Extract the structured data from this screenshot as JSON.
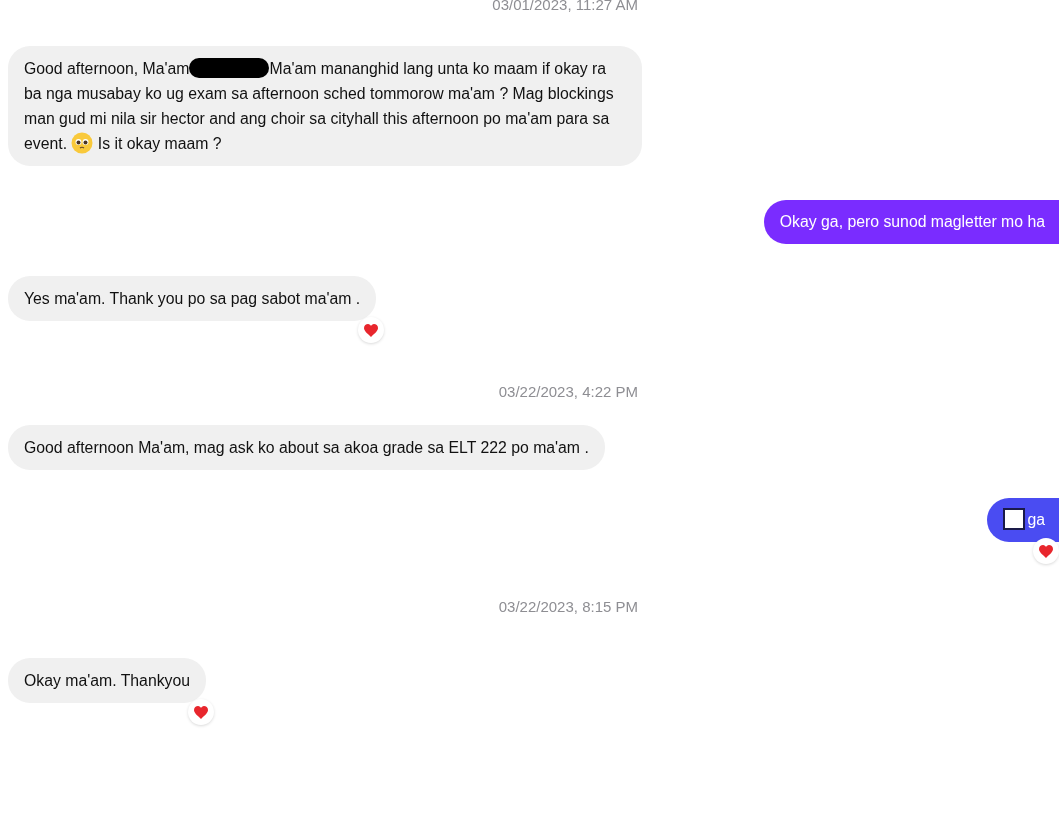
{
  "messages": [
    {
      "kind": "timestamp",
      "text": "03/01/2023, 11:27 AM"
    },
    {
      "kind": "incoming",
      "reacted": false,
      "parts": [
        {
          "kind": "text",
          "text": "Good afternoon, Ma'am"
        },
        {
          "kind": "redaction"
        },
        {
          "kind": "text",
          "text": "Ma'am mananghid lang unta ko maam if okay ra ba nga musabay ko ug exam sa afternoon sched tommorow ma'am ? Mag blockings man gud mi nila sir hector and ang choir sa cityhall this afternoon po ma'am para sa event. "
        },
        {
          "kind": "emoji"
        },
        {
          "kind": "text",
          "text": " Is it okay maam ?"
        }
      ]
    },
    {
      "kind": "outgoing",
      "color": "#7a2cff",
      "reacted": false,
      "parts": [
        {
          "kind": "text",
          "text": "Okay ga, pero sunod magletter mo ha"
        }
      ]
    },
    {
      "kind": "incoming",
      "reacted": true,
      "parts": [
        {
          "kind": "text",
          "text": "Yes ma'am. Thank you po sa pag sabot ma'am ."
        }
      ]
    },
    {
      "kind": "timestamp",
      "text": "03/22/2023, 4:22 PM"
    },
    {
      "kind": "incoming",
      "reacted": false,
      "parts": [
        {
          "kind": "text",
          "text": "Good afternoon Ma'am, mag ask ko about sa akoa grade sa ELT 222 po ma'am ."
        }
      ]
    },
    {
      "kind": "outgoing",
      "color": "#4a4cf2",
      "reacted": true,
      "parts": [
        {
          "kind": "missing-glyph"
        },
        {
          "kind": "text",
          "text": "ga"
        }
      ]
    },
    {
      "kind": "timestamp",
      "text": "03/22/2023, 8:15 PM"
    },
    {
      "kind": "incoming",
      "reacted": true,
      "parts": [
        {
          "kind": "text",
          "text": "Okay ma'am. Thankyou"
        }
      ]
    }
  ]
}
